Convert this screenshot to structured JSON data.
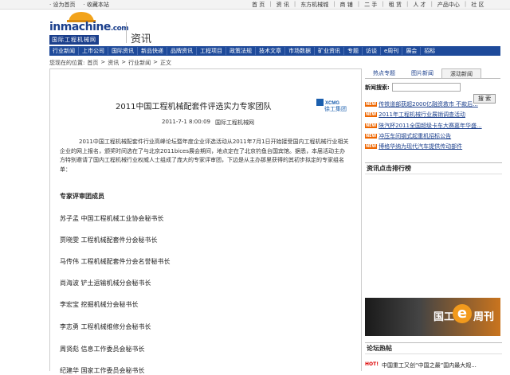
{
  "topbar": {
    "left": [
      "· 设为首页",
      "· 收藏本站"
    ],
    "right": [
      "首 页",
      "资 讯",
      "东方机械城",
      "商 铺",
      "二 手",
      "租 赁",
      "人 才",
      "产品中心",
      "社 区"
    ]
  },
  "logo": {
    "brand": "inmachine",
    "tld": ".com",
    "subtitle": "国际工程机械网"
  },
  "section_title": "资讯",
  "nav": [
    "行业新闻",
    "上市公司",
    "国际资讯",
    "新品快递",
    "品牌资讯",
    "工程项目",
    "政策法规",
    "技术文章",
    "市场数据",
    "矿业资讯",
    "专题",
    "访谈",
    "e周刊",
    "展会",
    "招标"
  ],
  "breadcrumb": {
    "prefix": "您现在的位置:",
    "items": [
      "首页",
      "资讯",
      "行业新闻",
      "正文"
    ],
    "sep": ">"
  },
  "article": {
    "title": "2011中国工程机械配套件评选实力专家团队",
    "stamp": "徐工集团",
    "date": "2011-7-1 8:00:09",
    "source": "国际工程机械网",
    "body": "2011中国工程机械配套件行业高峰论坛暨年度企业评选活动从2011年7月1日开始接受国内工程机械行业相关企业的网上报名，颁奖时间选在了与北京2011bices展会期间，地点定在了北京钓鱼台国宾馆。据悉，本届活动主办方特别邀请了国内工程机械行业权威人士组成了庞大的专家评审团，下边是从主办那里获得的其初步拟定的专家组名单：",
    "experts_heading": "专家评审团成员",
    "experts": [
      "苏子孟  中国工程机械工业协会秘书长",
      "贾晓雯  工程机械配套件分会秘书长",
      "马传伟  工程机械配套件分会名誉秘书长",
      "尚海波  铲土运输机械分会秘书长",
      "李宏宝  挖掘机械分会秘书长",
      "李志勇  工程机械维修分会秘书长",
      "周贤彪  信息工作委员会秘书长",
      "纪建华  国家工作委员会秘书长"
    ]
  },
  "sidebar": {
    "tabs": [
      "热点专题",
      "图片新闻",
      "滚动新闻"
    ],
    "active_tab": 2,
    "search_label": "新闻搜索:",
    "search_value": "",
    "search_button": "搜 索",
    "news_badge": "NEW",
    "news": [
      "传铁道部获超2000亿融资救市 不款后...",
      "2011年工程机械行业展销调查活动",
      "陕汽杯2011全国超级卡车大赛嘉年华盛...",
      "冲压车间钢式起重机招标公告",
      "博格华纳为现代汽车提供传动部件"
    ],
    "ranking_title": "资讯点击排行榜",
    "banner": {
      "word": "国工",
      "e": "e",
      "suffix": "周刊"
    },
    "forum_title": "论坛热帖",
    "forum_hot": "HOT!",
    "forum_item": "中国重工又创“中国之最”国内最大规..."
  },
  "colors": {
    "nav_bg": "#1e4a9a",
    "brand": "#1b3f8c",
    "link": "#1b3f8c",
    "badge": "#e60"
  }
}
